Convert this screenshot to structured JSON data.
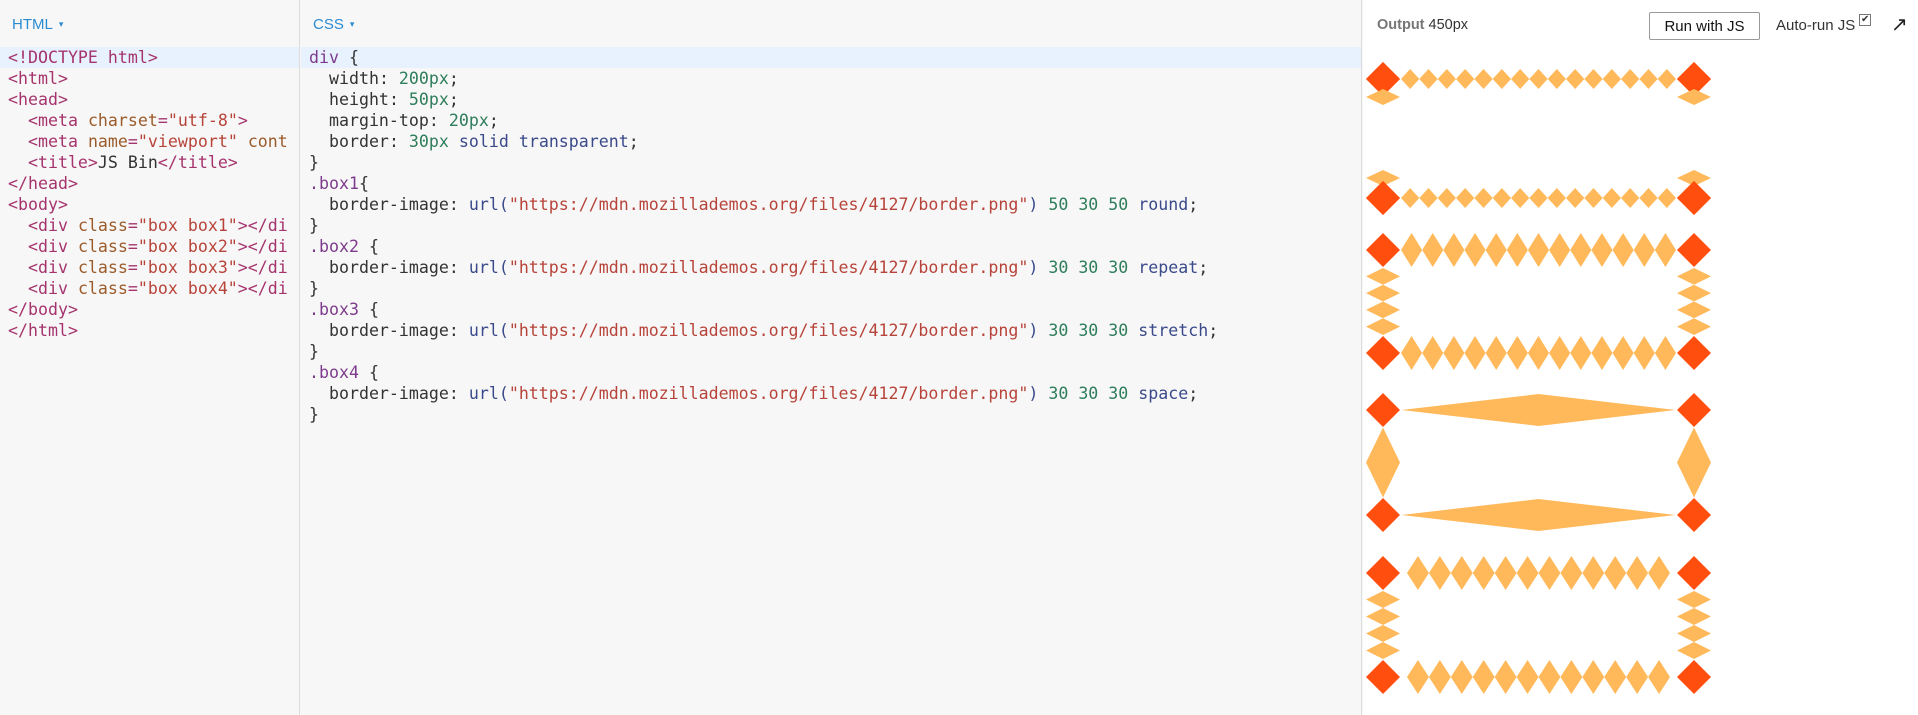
{
  "html_panel": {
    "label": "HTML",
    "caret": "▾",
    "lines": [
      [
        "tag:<!DOCTYPE html>"
      ],
      [
        "tag:<html>"
      ],
      [
        "tag:<head>"
      ],
      [
        "txt:  ",
        "tag:<meta ",
        "attr:charset",
        "tag:=",
        "str:\"utf-8\"",
        "tag:>"
      ],
      [
        "txt:  ",
        "tag:<meta ",
        "attr:name",
        "tag:=",
        "str:\"viewport\"",
        "txt: ",
        "attr:cont"
      ],
      [
        "txt:  ",
        "tag:<title>",
        "txt:JS Bin",
        "tag:</title>"
      ],
      [
        "tag:</head>"
      ],
      [
        "tag:<body>"
      ],
      [
        "txt:  ",
        "tag:<div ",
        "attr:class",
        "tag:=",
        "str:\"box box1\"",
        "tag:></di"
      ],
      [
        "txt:  ",
        "tag:<div ",
        "attr:class",
        "tag:=",
        "str:\"box box2\"",
        "tag:></di"
      ],
      [
        "txt:  ",
        "tag:<div ",
        "attr:class",
        "tag:=",
        "str:\"box box3\"",
        "tag:></di"
      ],
      [
        "txt:  ",
        "tag:<div ",
        "attr:class",
        "tag:=",
        "str:\"box box4\"",
        "tag:></di"
      ],
      [
        "tag:</body>"
      ],
      [
        "tag:</html>"
      ]
    ]
  },
  "css_panel": {
    "label": "CSS",
    "caret": "▾",
    "lines": [
      [
        "sel:div",
        "txt: {"
      ],
      [
        "txt:  ",
        "prop:width",
        "txt:: ",
        "num:200px",
        "txt:;"
      ],
      [
        "txt:  ",
        "prop:height",
        "txt:: ",
        "num:50px",
        "txt:;"
      ],
      [
        "txt:  ",
        "prop:margin-top",
        "txt:: ",
        "num:20px",
        "txt:;"
      ],
      [
        "txt:  ",
        "prop:border",
        "txt:: ",
        "num:30px",
        "txt: ",
        "kw:solid",
        "txt: ",
        "kw:transparent",
        "txt:;"
      ],
      [
        "txt:}"
      ],
      [
        "sel:.box1",
        "txt:{"
      ],
      [
        "txt:  ",
        "prop:border-image",
        "txt:: ",
        "fn:url(",
        "str:\"https://mdn.mozillademos.org/files/4127/border.png\"",
        "fn:)",
        "txt: ",
        "num:50",
        "txt: ",
        "num:30",
        "txt: ",
        "num:50",
        "txt: ",
        "kw:round",
        "txt:;"
      ],
      [
        "txt:}"
      ],
      [
        "sel:.box2",
        "txt: {"
      ],
      [
        "txt:  ",
        "prop:border-image",
        "txt:: ",
        "fn:url(",
        "str:\"https://mdn.mozillademos.org/files/4127/border.png\"",
        "fn:)",
        "txt: ",
        "num:30",
        "txt: ",
        "num:30",
        "txt: ",
        "num:30",
        "txt: ",
        "kw:repeat",
        "txt:;"
      ],
      [
        "txt:}"
      ],
      [
        "sel:.box3",
        "txt: {"
      ],
      [
        "txt:  ",
        "prop:border-image",
        "txt:: ",
        "fn:url(",
        "str:\"https://mdn.mozillademos.org/files/4127/border.png\"",
        "fn:)",
        "txt: ",
        "num:30",
        "txt: ",
        "num:30",
        "txt: ",
        "num:30",
        "txt: ",
        "kw:stretch",
        "txt:;"
      ],
      [
        "txt:}"
      ],
      [
        "sel:.box4",
        "txt: {"
      ],
      [
        "txt:  ",
        "prop:border-image",
        "txt:: ",
        "fn:url(",
        "str:\"https://mdn.mozillademos.org/files/4127/border.png\"",
        "fn:)",
        "txt: ",
        "num:30",
        "txt: ",
        "num:30",
        "txt: ",
        "num:30",
        "txt: ",
        "kw:space",
        "txt:;"
      ],
      [
        "txt:}"
      ]
    ]
  },
  "output_panel": {
    "title": "Output",
    "width_label": "450px",
    "run_button": "Run with JS",
    "autorun_label": "Auto-run JS",
    "autorun_checked": "✔",
    "expand_icon": "↗",
    "colors": {
      "corner": "#ff4e0e",
      "edge": "#ffb95a"
    },
    "boxes": [
      {
        "class": "box1",
        "mode": "round"
      },
      {
        "class": "box2",
        "mode": "repeat"
      },
      {
        "class": "box3",
        "mode": "stretch"
      },
      {
        "class": "box4",
        "mode": "space"
      }
    ]
  }
}
